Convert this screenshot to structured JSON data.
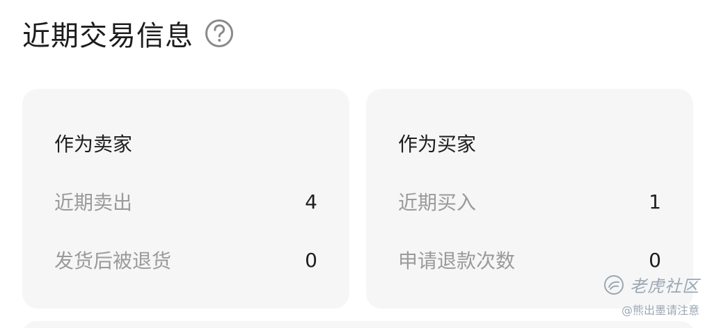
{
  "header": {
    "title": "近期交易信息",
    "help_icon": "question-circle-icon"
  },
  "seller": {
    "title": "作为卖家",
    "rows": [
      {
        "label": "近期卖出",
        "value": "4"
      },
      {
        "label": "发货后被退货",
        "value": "0"
      }
    ]
  },
  "buyer": {
    "title": "作为买家",
    "rows": [
      {
        "label": "近期买入",
        "value": "1"
      },
      {
        "label": "申请退款次数",
        "value": "0"
      }
    ]
  },
  "watermark": {
    "brand": "老虎社区",
    "author": "@熊出墨请注意"
  },
  "colors": {
    "card_background": "#f6f6f6",
    "label_gray": "#9a9a9a",
    "text_dark": "#1e1e1e"
  }
}
